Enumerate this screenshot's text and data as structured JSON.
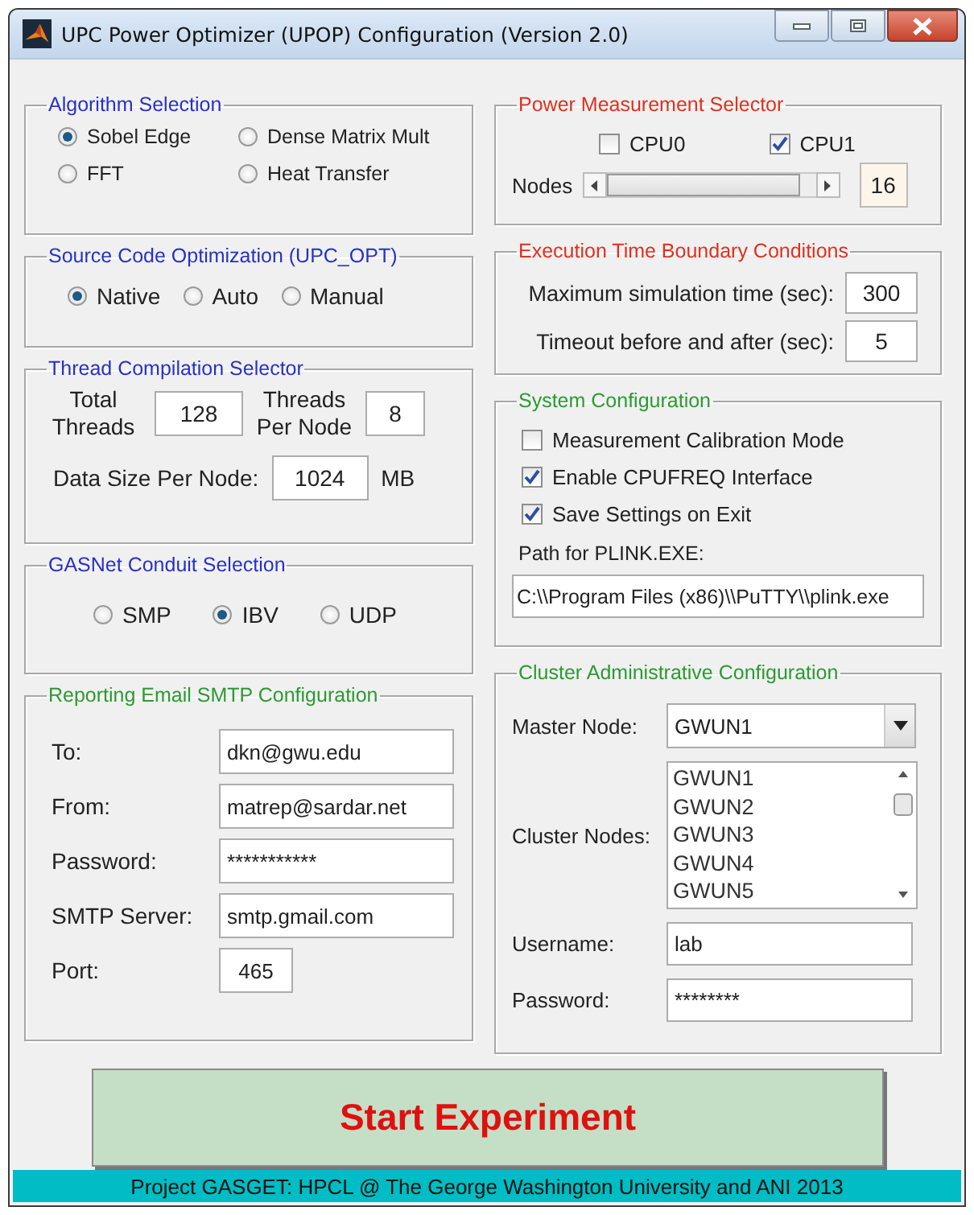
{
  "window": {
    "title": "UPC Power Optimizer (UPOP) Configuration (Version 2.0)"
  },
  "algorithm_selection": {
    "title": "Algorithm Selection",
    "options": [
      {
        "label": "Sobel Edge",
        "selected": true
      },
      {
        "label": "Dense Matrix Mult",
        "selected": false
      },
      {
        "label": "FFT",
        "selected": false
      },
      {
        "label": "Heat Transfer",
        "selected": false
      }
    ]
  },
  "source_code_optimization": {
    "title": "Source Code Optimization (UPC_OPT)",
    "options": [
      {
        "label": "Native",
        "selected": true
      },
      {
        "label": "Auto",
        "selected": false
      },
      {
        "label": "Manual",
        "selected": false
      }
    ]
  },
  "thread_compilation": {
    "title": "Thread Compilation Selector",
    "total_threads": {
      "label": "Total Threads",
      "value": "128"
    },
    "threads_per_node": {
      "label": "Threads Per Node",
      "value": "8"
    },
    "data_size": {
      "label": "Data Size Per Node:",
      "value": "1024",
      "unit": "MB"
    }
  },
  "gasnet_conduit": {
    "title": "GASNet Conduit Selection",
    "options": [
      {
        "label": "SMP",
        "selected": false
      },
      {
        "label": "IBV",
        "selected": true
      },
      {
        "label": "UDP",
        "selected": false
      }
    ]
  },
  "reporting_email": {
    "title": "Reporting Email SMTP Configuration",
    "fields": [
      {
        "label": "To:",
        "value": "dkn@gwu.edu"
      },
      {
        "label": "From:",
        "value": "matrep@sardar.net"
      },
      {
        "label": "Password:",
        "value": "***********"
      },
      {
        "label": "SMTP Server:",
        "value": "smtp.gmail.com"
      },
      {
        "label": "Port:",
        "value": "465",
        "kind": "short"
      }
    ]
  },
  "power_measurement": {
    "title": "Power Measurement Selector",
    "cpus": [
      {
        "label": "CPU0",
        "checked": false
      },
      {
        "label": "CPU1",
        "checked": true
      }
    ],
    "nodes": {
      "label": "Nodes",
      "level": 0.93,
      "value": "16"
    }
  },
  "execution_time": {
    "title": "Execution Time Boundary Conditions",
    "fields": [
      {
        "label": "Maximum simulation time (sec):",
        "value": "300"
      },
      {
        "label": "Timeout before and after (sec):",
        "value": "5"
      }
    ]
  },
  "system_configuration": {
    "title": "System Configuration",
    "options": [
      {
        "label": "Measurement Calibration Mode",
        "checked": false
      },
      {
        "label": "Enable CPUFREQ Interface",
        "checked": true
      },
      {
        "label": "Save Settings on Exit",
        "checked": true
      }
    ],
    "path": {
      "label": "Path for PLINK.EXE:",
      "value": "C:\\\\Program Files (x86)\\\\PuTTY\\\\plink.exe"
    }
  },
  "cluster_configuration": {
    "title": "Cluster Administrative Configuration",
    "master_node": {
      "label": "Master Node:",
      "value": "GWUN1"
    },
    "cluster_nodes": {
      "label": "Cluster Nodes:",
      "items": [
        "GWUN1",
        "GWUN2",
        "GWUN3",
        "GWUN4",
        "GWUN5"
      ]
    },
    "fields": [
      {
        "label": "Username:",
        "value": "lab"
      },
      {
        "label": "Password:",
        "value": "********"
      }
    ]
  },
  "start_button": {
    "label": "Start Experiment"
  },
  "status_bar": {
    "text": "Project GASGET: HPCL @ The George Washington University and ANI 2013"
  }
}
